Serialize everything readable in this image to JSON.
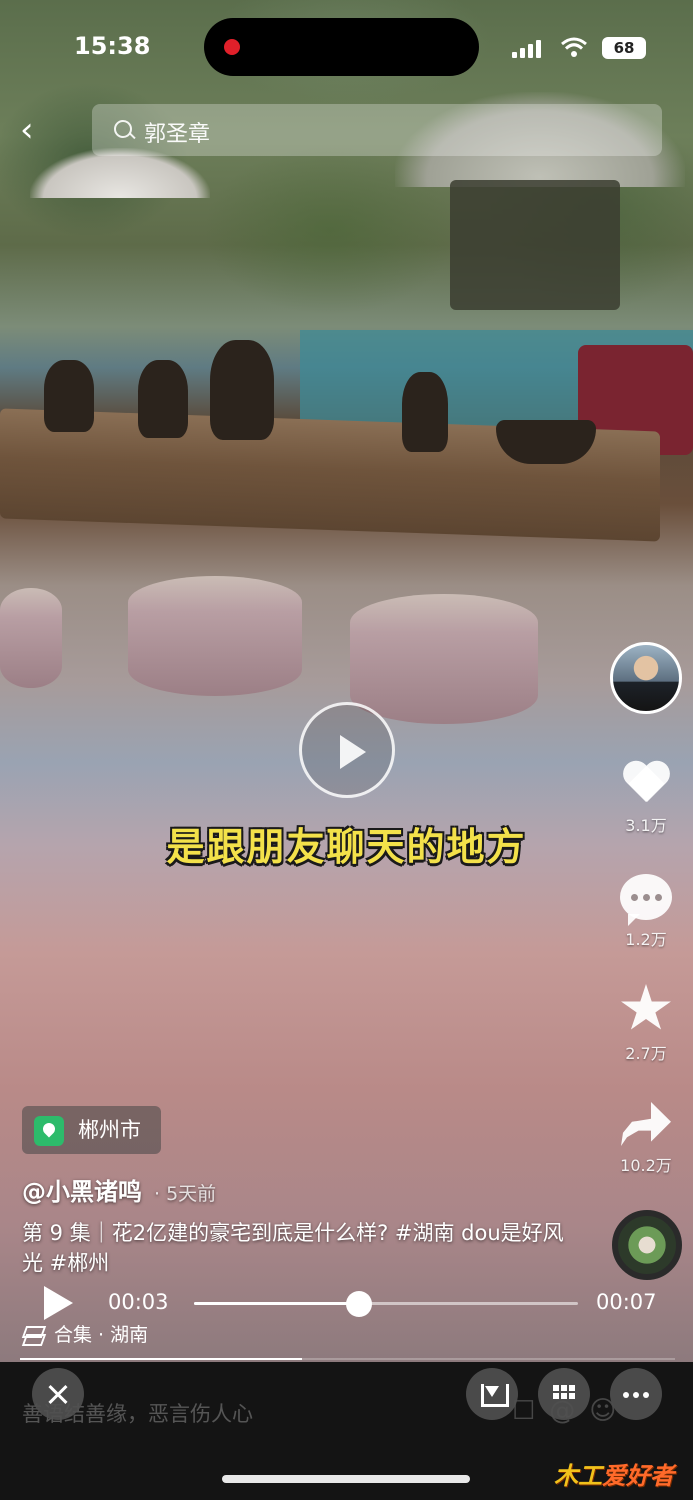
{
  "status_bar": {
    "time": "15:38",
    "battery": "68"
  },
  "search": {
    "query": "郭圣章"
  },
  "video": {
    "subtitle": "是跟朋友聊天的地方"
  },
  "actions": {
    "likes": "3.1万",
    "comments": "1.2万",
    "favorites": "2.7万",
    "shares": "10.2万"
  },
  "info": {
    "location": "郴州市",
    "author": "@小黑诸鸣",
    "posted_ago": "· 5天前",
    "caption": "第 9 集｜花2亿建的豪宅到底是什么样? #湖南 dou是好风光 #郴州",
    "collection": "合集 · 湖南"
  },
  "player": {
    "current_time": "00:03",
    "duration": "00:07",
    "progress": 0.43
  },
  "comment_hint": "善语结善缘，恶言伤人心",
  "watermark": {
    "part1": "木工",
    "part2": "爱好者"
  },
  "colors": {
    "subtitle": "#f3e14a",
    "location_pin": "#2dbb6b",
    "record_dot": "#e0202a"
  }
}
